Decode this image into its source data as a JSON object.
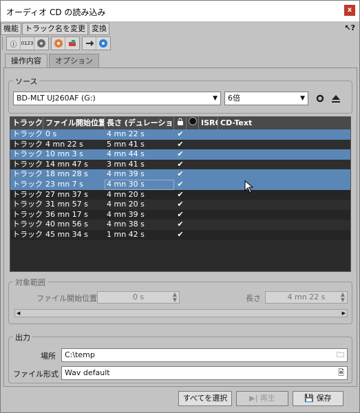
{
  "window": {
    "title": "オーディオ CD の読み込み",
    "close": "x"
  },
  "menubar": {
    "items": [
      "機能",
      "トラック名を変更",
      "変換"
    ],
    "help": "↖?"
  },
  "toolbar": {
    "btn_info": "ⓘ",
    "btn_numbers": "0123"
  },
  "tabs": [
    "操作内容",
    "オプション"
  ],
  "source": {
    "legend": "ソース",
    "drive": "BD-MLT UJ260AF (G:)",
    "speed": "6倍"
  },
  "table": {
    "headers": [
      "トラック",
      "ファイル開始位置",
      "長さ (デュレーション)",
      "",
      "",
      "ISRC",
      "CD-Text"
    ],
    "rows": [
      {
        "track": "トラック ...",
        "start": "0 s",
        "length": "4 mn 22 s",
        "check": "✔",
        "selected": true
      },
      {
        "track": "トラック ...",
        "start": "4 mn 22 s",
        "length": "5 mn 41 s",
        "check": "✔",
        "selected": false
      },
      {
        "track": "トラック ...",
        "start": "10 mn 3 s",
        "length": "4 mn 44 s",
        "check": "✔",
        "selected": true
      },
      {
        "track": "トラック ...",
        "start": "14 mn 47 s",
        "length": "3 mn 41 s",
        "check": "✔",
        "selected": false
      },
      {
        "track": "トラック ...",
        "start": "18 mn 28 s",
        "length": "4 mn 39 s",
        "check": "✔",
        "selected": true
      },
      {
        "track": "トラック ...",
        "start": "23 mn 7 s",
        "length": "4 mn 30 s",
        "check": "✔",
        "selected": true
      },
      {
        "track": "トラック ...",
        "start": "27 mn 37 s",
        "length": "4 mn 20 s",
        "check": "✔",
        "selected": false
      },
      {
        "track": "トラック ...",
        "start": "31 mn 57 s",
        "length": "4 mn 20 s",
        "check": "✔",
        "selected": false
      },
      {
        "track": "トラック ...",
        "start": "36 mn 17 s",
        "length": "4 mn 39 s",
        "check": "✔",
        "selected": false
      },
      {
        "track": "トラック ...",
        "start": "40 mn 56 s",
        "length": "4 mn 38 s",
        "check": "✔",
        "selected": false
      },
      {
        "track": "トラック ...",
        "start": "45 mn 34 s",
        "length": "1 mn 42 s",
        "check": "✔",
        "selected": false
      }
    ]
  },
  "range": {
    "legend": "対象範囲",
    "start_label": "ファイル開始位置",
    "start_value": "0 s",
    "length_label": "長さ",
    "length_value": "4 mn 22 s"
  },
  "output": {
    "legend": "出力",
    "location_label": "場所",
    "location_value": "C:\\temp",
    "format_label": "ファイル形式",
    "format_value": "Wav default"
  },
  "buttons": {
    "select_all": "すべてを選択",
    "play": "▶| 再生",
    "save": "保存"
  }
}
